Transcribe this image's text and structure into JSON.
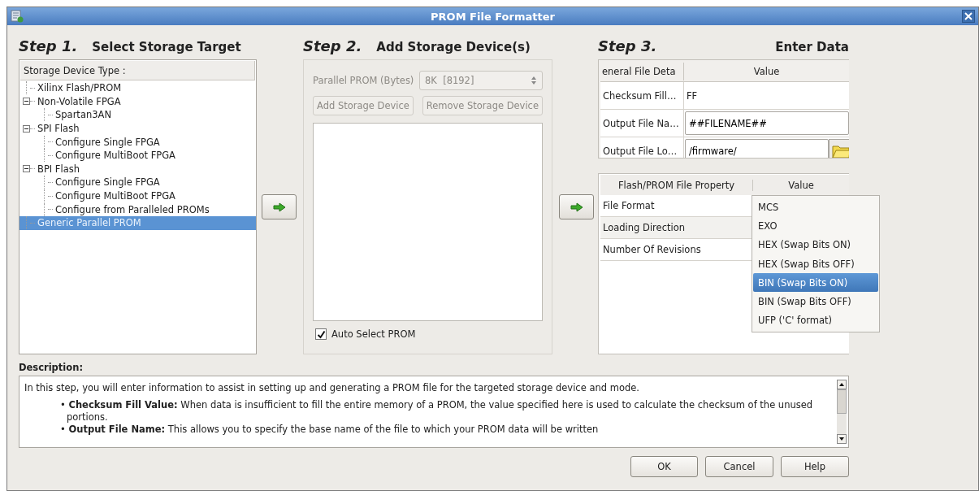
{
  "window": {
    "title": "PROM File Formatter"
  },
  "steps": [
    {
      "number": "Step 1.",
      "title": "Select Storage Target"
    },
    {
      "number": "Step 2.",
      "title": "Add Storage Device(s)"
    },
    {
      "number": "Step 3.",
      "title": "Enter Data"
    }
  ],
  "tree": {
    "header": "Storage Device Type :",
    "items": [
      {
        "label": "Xilinx Flash/PROM",
        "selected": false
      },
      {
        "label": "Non-Volatile FPGA",
        "selected": false,
        "expanded": true,
        "children": [
          {
            "label": "Spartan3AN",
            "selected": false
          }
        ]
      },
      {
        "label": "SPI Flash",
        "selected": false,
        "expanded": true,
        "children": [
          {
            "label": "Configure Single FPGA",
            "selected": false
          },
          {
            "label": "Configure MultiBoot FPGA",
            "selected": false
          }
        ]
      },
      {
        "label": "BPI Flash",
        "selected": false,
        "expanded": true,
        "children": [
          {
            "label": "Configure Single FPGA",
            "selected": false
          },
          {
            "label": "Configure MultiBoot FPGA",
            "selected": false
          },
          {
            "label": "Configure from Paralleled PROMs",
            "selected": false
          }
        ]
      },
      {
        "label": "Generic Parallel PROM",
        "selected": true
      }
    ]
  },
  "device_panel": {
    "disabled": true,
    "size_label": "Parallel PROM (Bytes)",
    "size_value": "8K  [8192]",
    "add_button": "Add Storage Device",
    "remove_button": "Remove Storage Device",
    "auto_select": {
      "label": "Auto Select PROM",
      "checked": true
    }
  },
  "general_table": {
    "columns": [
      "eneral File Deta",
      "Value"
    ],
    "rows": [
      {
        "kind": "text",
        "name": "Checksum Fill…",
        "value": "FF"
      },
      {
        "kind": "input",
        "name": "Output File Na…",
        "value": "##FILENAME##"
      },
      {
        "kind": "browse",
        "name": "Output File Lo…",
        "value": "/firmware/"
      }
    ]
  },
  "property_table": {
    "columns": [
      "Flash/PROM File Property",
      "Value"
    ],
    "rows": [
      "File Format",
      "Loading Direction",
      "Number Of Revisions"
    ]
  },
  "format_dropdown": {
    "options": [
      {
        "label": "MCS",
        "selected": false
      },
      {
        "label": "EXO",
        "selected": false
      },
      {
        "label": "HEX (Swap Bits ON)",
        "selected": false
      },
      {
        "label": "HEX (Swap Bits OFF)",
        "selected": false
      },
      {
        "label": "BIN (Swap Bits ON)",
        "selected": true
      },
      {
        "label": "BIN (Swap Bits OFF)",
        "selected": false
      },
      {
        "label": "UFP ('C' format)",
        "selected": false
      }
    ]
  },
  "description": {
    "label": "Description:",
    "intro": "In this step, you will enter information to assist in setting up and generating a PROM file for the targeted storage device and mode.",
    "bullets": [
      "• **Checksum Fill Value:** When data is insufficient to fill the entire memory of a PROM, the value specified here is used to calculate the checksum of the unused portions.",
      "• **Output File Name:** This allows you to specify the base name of the file to which your PROM data will be written"
    ]
  },
  "buttons": [
    "OK",
    "Cancel",
    "Help"
  ]
}
